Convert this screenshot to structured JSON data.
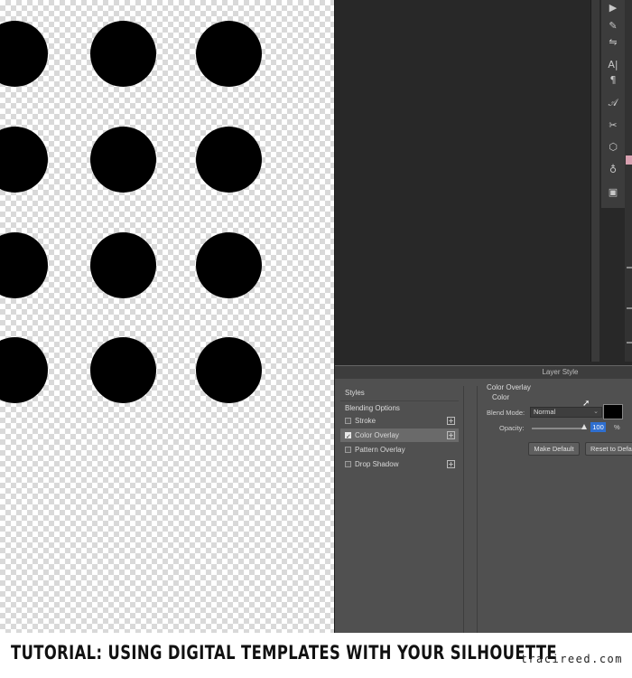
{
  "canvas": {
    "dot_rows": 4,
    "dot_cols": 3
  },
  "tool_icons": [
    "play-icon",
    "brush-icon",
    "adjust-icon",
    "type-icon",
    "paragraph-icon",
    "glyph-icon",
    "tools-icon",
    "cube-icon",
    "bulb-icon",
    "screen-icon"
  ],
  "dialog": {
    "title": "Layer Style",
    "left_panel": {
      "header": "Styles",
      "blending": "Blending Options",
      "items": [
        {
          "label": "Stroke",
          "checked": false,
          "has_add": true
        },
        {
          "label": "Color Overlay",
          "checked": true,
          "has_add": true
        },
        {
          "label": "Pattern Overlay",
          "checked": false,
          "has_add": false
        },
        {
          "label": "Drop Shadow",
          "checked": false,
          "has_add": true
        }
      ]
    },
    "color_overlay": {
      "section_title": "Color Overlay",
      "sub_title": "Color",
      "blend_mode_label": "Blend Mode:",
      "blend_mode_value": "Normal",
      "overlay_color": "#000000",
      "opacity_label": "Opacity:",
      "opacity_value": "100",
      "opacity_unit": "%",
      "make_default": "Make Default",
      "reset_default": "Reset to Defa"
    }
  },
  "caption": {
    "title": "TUTORIAL: USING DIGITAL TEMPLATES WITH YOUR SILHOUETTE",
    "site": "tracireed.com"
  }
}
